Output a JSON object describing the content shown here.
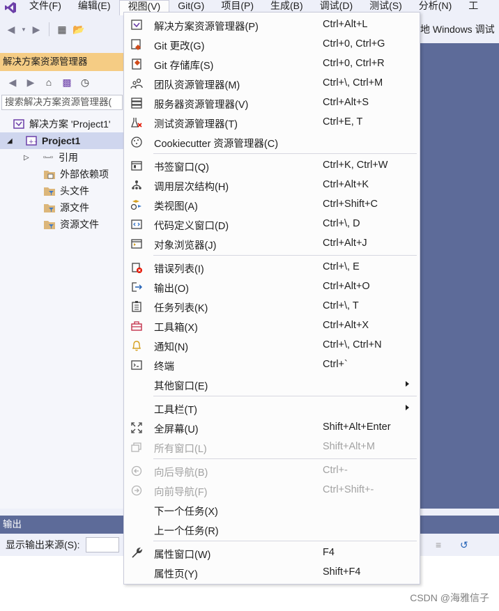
{
  "menubar": {
    "items": [
      "文件(F)",
      "编辑(E)",
      "视图(V)",
      "Git(G)",
      "项目(P)",
      "生成(B)",
      "调试(D)",
      "测试(S)",
      "分析(N)",
      "工"
    ],
    "active_index": 2
  },
  "toolbar": {
    "target_text": "地 Windows 调试"
  },
  "solution_explorer": {
    "title": "解决方案资源管理器",
    "search_placeholder": "搜索解决方案资源管理器(",
    "solution": "解决方案 'Project1'",
    "project": "Project1",
    "children": [
      "引用",
      "外部依赖项",
      "头文件",
      "源文件",
      "资源文件"
    ]
  },
  "output": {
    "title": "输出",
    "source_label": "显示输出来源(S):"
  },
  "watermark": "CSDN @海雅信子",
  "view_menu": {
    "groups": [
      [
        {
          "label": "解决方案资源管理器(P)",
          "shortcut": "Ctrl+Alt+L",
          "icon": "solution-explorer-icon"
        },
        {
          "label": "Git 更改(G)",
          "shortcut": "Ctrl+0, Ctrl+G",
          "icon": "git-changes-icon"
        },
        {
          "label": "Git 存储库(S)",
          "shortcut": "Ctrl+0, Ctrl+R",
          "icon": "git-repository-icon"
        },
        {
          "label": "团队资源管理器(M)",
          "shortcut": "Ctrl+\\, Ctrl+M",
          "icon": "team-explorer-icon"
        },
        {
          "label": "服务器资源管理器(V)",
          "shortcut": "Ctrl+Alt+S",
          "icon": "server-explorer-icon"
        },
        {
          "label": "测试资源管理器(T)",
          "shortcut": "Ctrl+E, T",
          "icon": "test-explorer-icon"
        },
        {
          "label": "Cookiecutter 资源管理器(C)",
          "shortcut": "",
          "icon": "cookiecutter-icon"
        }
      ],
      [
        {
          "label": "书签窗口(Q)",
          "shortcut": "Ctrl+K, Ctrl+W",
          "icon": "bookmark-window-icon"
        },
        {
          "label": "调用层次结构(H)",
          "shortcut": "Ctrl+Alt+K",
          "icon": "call-hierarchy-icon"
        },
        {
          "label": "类视图(A)",
          "shortcut": "Ctrl+Shift+C",
          "icon": "class-view-icon"
        },
        {
          "label": "代码定义窗口(D)",
          "shortcut": "Ctrl+\\, D",
          "icon": "code-definition-icon"
        },
        {
          "label": "对象浏览器(J)",
          "shortcut": "Ctrl+Alt+J",
          "icon": "object-browser-icon"
        }
      ],
      [
        {
          "label": "错误列表(I)",
          "shortcut": "Ctrl+\\, E",
          "icon": "error-list-icon"
        },
        {
          "label": "输出(O)",
          "shortcut": "Ctrl+Alt+O",
          "icon": "output-icon"
        },
        {
          "label": "任务列表(K)",
          "shortcut": "Ctrl+\\, T",
          "icon": "task-list-icon"
        },
        {
          "label": "工具箱(X)",
          "shortcut": "Ctrl+Alt+X",
          "icon": "toolbox-icon"
        },
        {
          "label": "通知(N)",
          "shortcut": "Ctrl+\\, Ctrl+N",
          "icon": "bell-icon"
        },
        {
          "label": "终端",
          "shortcut": "Ctrl+`",
          "icon": "terminal-icon"
        },
        {
          "label": "其他窗口(E)",
          "shortcut": "",
          "icon": "",
          "submenu": true
        }
      ],
      [
        {
          "label": "工具栏(T)",
          "shortcut": "",
          "icon": "",
          "submenu": true
        },
        {
          "label": "全屏幕(U)",
          "shortcut": "Shift+Alt+Enter",
          "icon": "fullscreen-icon"
        },
        {
          "label": "所有窗口(L)",
          "shortcut": "Shift+Alt+M",
          "icon": "all-windows-icon",
          "disabled": true
        }
      ],
      [
        {
          "label": "向后导航(B)",
          "shortcut": "Ctrl+-",
          "icon": "navigate-back-icon",
          "disabled": true
        },
        {
          "label": "向前导航(F)",
          "shortcut": "Ctrl+Shift+-",
          "icon": "navigate-forward-icon",
          "disabled": true
        },
        {
          "label": "下一个任务(X)",
          "shortcut": "",
          "icon": ""
        },
        {
          "label": "上一个任务(R)",
          "shortcut": "",
          "icon": ""
        }
      ],
      [
        {
          "label": "属性窗口(W)",
          "shortcut": "F4",
          "icon": "wrench-icon"
        },
        {
          "label": "属性页(Y)",
          "shortcut": "Shift+F4",
          "icon": ""
        }
      ]
    ]
  },
  "colors": {
    "accent": "#5d6b99",
    "highlight": "#f5cc84",
    "vs_purple": "#6c3fa8",
    "git_red": "#d14b1a",
    "error_red": "#e51400",
    "toolbox_red": "#c4314b"
  }
}
